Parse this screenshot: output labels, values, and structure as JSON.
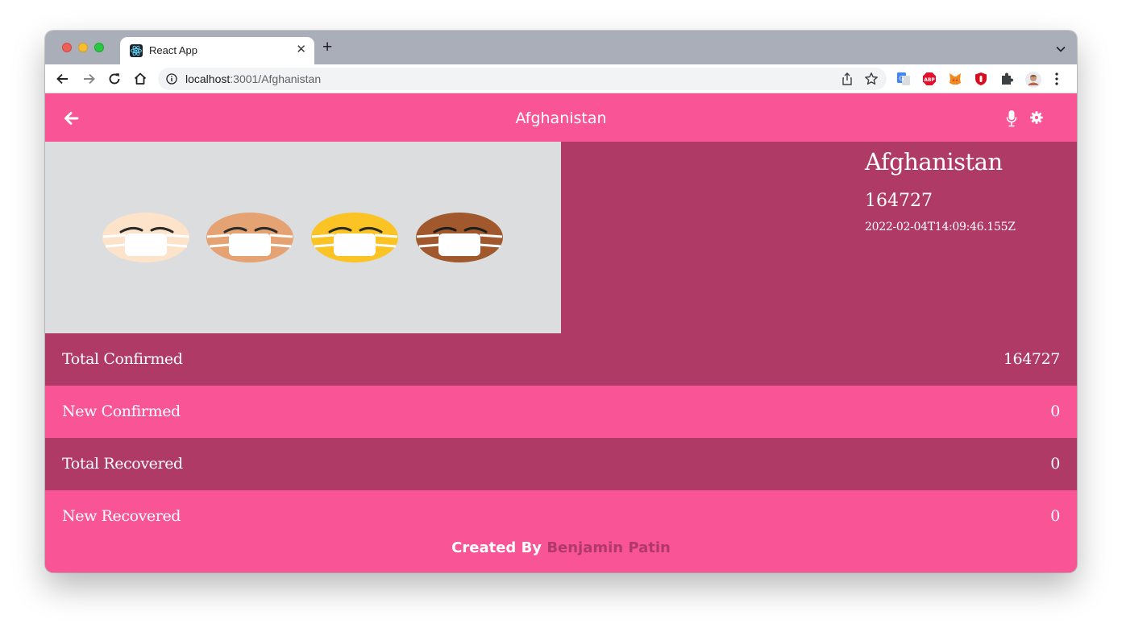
{
  "browser": {
    "tab_title": "React App",
    "url_host": "localhost",
    "url_path": ":3001/Afghanistan"
  },
  "app": {
    "header_title": "Afghanistan",
    "country_name": "Afghanistan",
    "country_total": "164727",
    "updated_at": "2022-02-04T14:09:46.155Z",
    "stats": [
      {
        "label": "Total Confirmed",
        "value": "164727"
      },
      {
        "label": "New Confirmed",
        "value": "0"
      },
      {
        "label": "Total Recovered",
        "value": "0"
      },
      {
        "label": "New Recovered",
        "value": "0"
      }
    ],
    "footer_prefix": "Created By",
    "footer_author": "Benjamin Patin"
  },
  "colors": {
    "primary_pink": "#f95496",
    "dark_pink": "#af3a65",
    "hero_image_bg": "#dcdddf"
  },
  "icons": {
    "back": "arrow-left-icon",
    "mic": "microphone-icon",
    "settings": "gear-icon",
    "hero": "masked-emoji-faces-image"
  }
}
